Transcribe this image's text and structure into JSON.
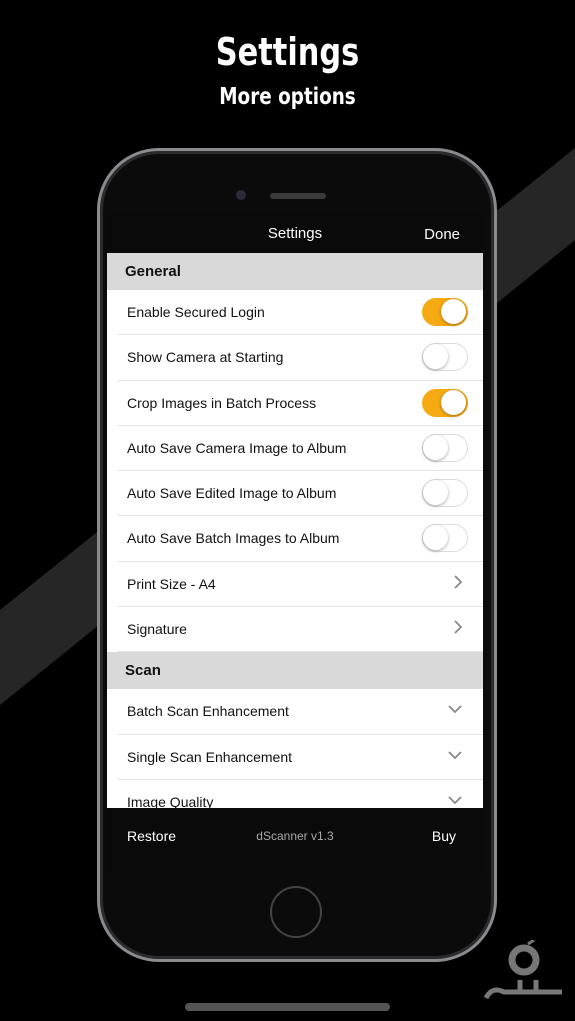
{
  "promo": {
    "title": "Settings",
    "subtitle": "More options"
  },
  "nav": {
    "title": "Settings",
    "done_label": "Done"
  },
  "sections": [
    {
      "title": "General",
      "rows": [
        {
          "label": "Enable Secured Login",
          "type": "toggle",
          "on": true
        },
        {
          "label": "Show Camera at Starting",
          "type": "toggle",
          "on": false
        },
        {
          "label": "Crop Images in Batch Process",
          "type": "toggle",
          "on": true
        },
        {
          "label": "Auto Save Camera Image to Album",
          "type": "toggle",
          "on": false
        },
        {
          "label": "Auto Save Edited Image to Album",
          "type": "toggle",
          "on": false
        },
        {
          "label": "Auto Save Batch Images to Album",
          "type": "toggle",
          "on": false
        },
        {
          "label": "Print Size - A4",
          "type": "chevron-right"
        },
        {
          "label": "Signature",
          "type": "chevron-right"
        }
      ]
    },
    {
      "title": "Scan",
      "rows": [
        {
          "label": "Batch Scan Enhancement",
          "type": "chevron-down"
        },
        {
          "label": "Single Scan Enhancement",
          "type": "chevron-down"
        },
        {
          "label": "Image Quality",
          "type": "chevron-down"
        }
      ]
    }
  ],
  "footer": {
    "restore_label": "Restore",
    "version": "dScanner v1.3",
    "buy_label": "Buy"
  },
  "colors": {
    "accent": "#f5a913",
    "background": "#000000",
    "band": "#2a2a2a"
  }
}
